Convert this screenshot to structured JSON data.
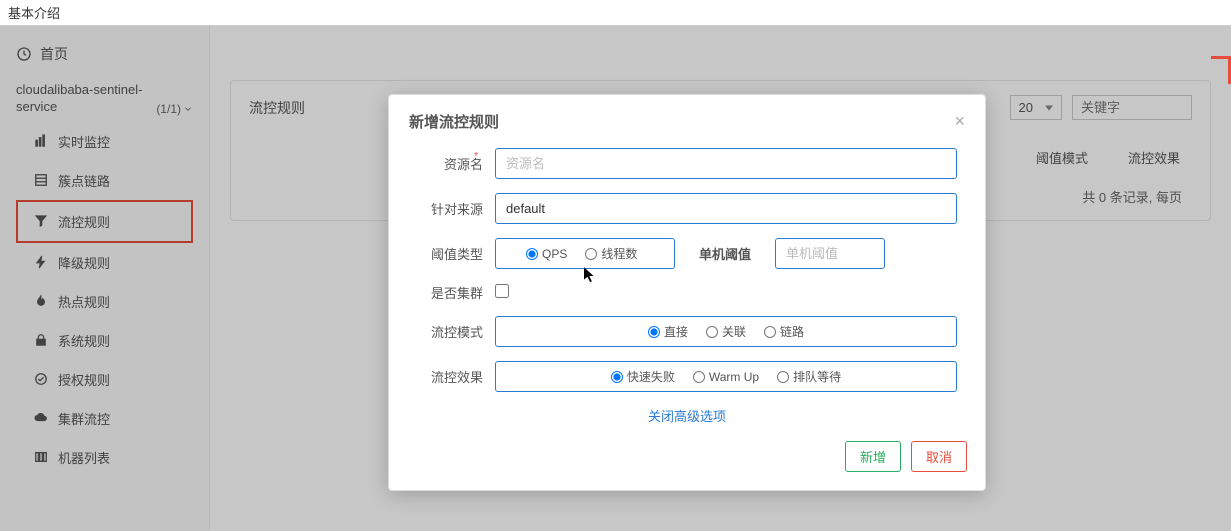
{
  "header": {
    "tab_title": "基本介绍"
  },
  "sidebar": {
    "home_label": "首页",
    "app_name": "cloudalibaba-sentinel-service",
    "app_counter": "(1/1)",
    "items": [
      {
        "label": "实时监控",
        "icon": "chart-bar-icon"
      },
      {
        "label": "簇点链路",
        "icon": "list-icon"
      },
      {
        "label": "流控规则",
        "icon": "filter-icon"
      },
      {
        "label": "降级规则",
        "icon": "bolt-icon"
      },
      {
        "label": "热点规则",
        "icon": "fire-icon"
      },
      {
        "label": "系统规则",
        "icon": "lock-icon"
      },
      {
        "label": "授权规则",
        "icon": "check-circle-icon"
      },
      {
        "label": "集群流控",
        "icon": "cloud-icon"
      },
      {
        "label": "机器列表",
        "icon": "server-icon"
      }
    ]
  },
  "content": {
    "page_title_bg": "cloudalibaba sentinel service",
    "panel_title": "流控规则",
    "page_size": "20",
    "keyword_placeholder": "关键字",
    "col_threshold_mode": "阈值模式",
    "col_flow_effect": "流控效果",
    "empty_text": "共 0 条记录, 每页"
  },
  "modal": {
    "title": "新增流控规则",
    "fields": {
      "resource_label": "资源名",
      "resource_placeholder": "资源名",
      "source_label": "针对来源",
      "source_value": "default",
      "threshold_type_label": "阈值类型",
      "threshold_type_options": {
        "qps": "QPS",
        "thread": "线程数"
      },
      "single_threshold_label": "单机阈值",
      "single_threshold_placeholder": "单机阈值",
      "cluster_label": "是否集群",
      "mode_label": "流控模式",
      "mode_options": {
        "direct": "直接",
        "relate": "关联",
        "chain": "链路"
      },
      "effect_label": "流控效果",
      "effect_options": {
        "fast_fail": "快速失败",
        "warm_up": "Warm Up",
        "queue": "排队等待"
      }
    },
    "toggle_advanced": "关闭高级选项",
    "buttons": {
      "submit": "新增",
      "cancel": "取消"
    }
  }
}
